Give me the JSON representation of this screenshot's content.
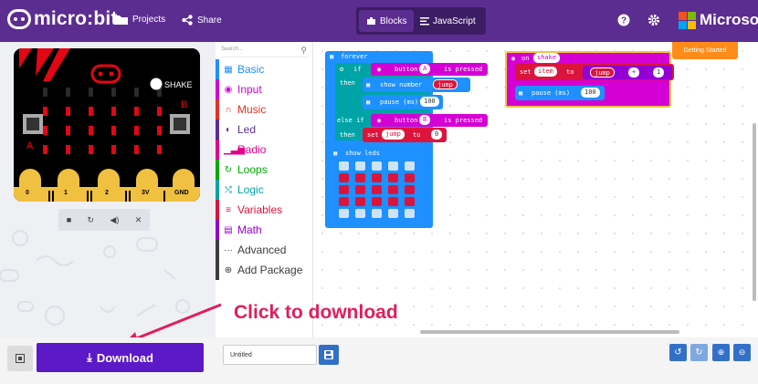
{
  "header": {
    "app_title": "micro:bit",
    "projects_label": "Projects",
    "share_label": "Share",
    "blocks_label": "Blocks",
    "javascript_label": "JavaScript",
    "microsoft_label": "Microsoft",
    "brand_color": "#5c2d91"
  },
  "simulator": {
    "shake_label": "SHAKE",
    "pins": [
      "0",
      "1",
      "2",
      "3V",
      "GND"
    ]
  },
  "toolbox": {
    "search_placeholder": "Search...",
    "categories": [
      {
        "label": "Basic",
        "icon": "grid-icon",
        "color": "#1e90ff"
      },
      {
        "label": "Input",
        "icon": "target-icon",
        "color": "#d400d4"
      },
      {
        "label": "Music",
        "icon": "headphones-icon",
        "color": "#e63022"
      },
      {
        "label": "Led",
        "icon": "toggle-icon",
        "color": "#5c2d91"
      },
      {
        "label": "Radio",
        "icon": "signal-icon",
        "color": "#e3008c"
      },
      {
        "label": "Loops",
        "icon": "refresh-icon",
        "color": "#00aa00"
      },
      {
        "label": "Logic",
        "icon": "shuffle-icon",
        "color": "#00a4a6"
      },
      {
        "label": "Variables",
        "icon": "list-icon",
        "color": "#dc143c"
      },
      {
        "label": "Math",
        "icon": "calculator-icon",
        "color": "#9400d3"
      },
      {
        "label": "Advanced",
        "icon": "more-icon",
        "color": "#3c3c3c"
      },
      {
        "label": "Add Package",
        "icon": "plus-circle-icon",
        "color": "#3c3c3c"
      }
    ]
  },
  "workspace": {
    "getting_started": "Getting Started",
    "forever_label": "forever",
    "if_label": "if",
    "then_label": "then",
    "else_if_label": "else if",
    "button_label": "button",
    "button_a": "A",
    "button_b": "B",
    "is_pressed_label": "is pressed",
    "show_number_label": "show number",
    "jump_label": "jump",
    "pause_label": "pause (ms)",
    "pause_value": "100",
    "set_label": "set",
    "to_label": "to",
    "zero_value": "0",
    "show_leds_label": "show leds",
    "on_label": "on",
    "shake_value": "shake",
    "item_label": "item",
    "plus_label": "+",
    "one_value": "1"
  },
  "footer": {
    "download_label": "Download",
    "project_name": "Untitled"
  },
  "annotation": {
    "click_to_download": "Click to download"
  }
}
